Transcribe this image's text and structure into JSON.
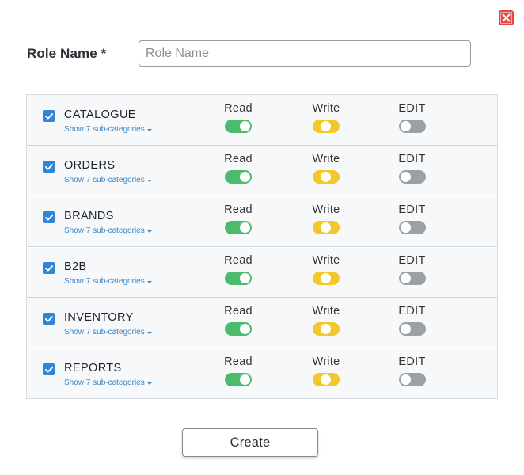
{
  "dialog": {
    "close_icon": "close-x-icon",
    "accent_color": "#e64545"
  },
  "role": {
    "label": "Role Name *",
    "placeholder": "Role Name",
    "value": ""
  },
  "permissions": {
    "columns": {
      "read": "Read",
      "write": "Write",
      "edit": "EDIT"
    },
    "sub_link": "Show 7 sub-categories",
    "colors": {
      "read": "#4cbb6c",
      "write": "#f3c82c",
      "edit": "#9aa0a6",
      "checkbox": "#2f86d8",
      "link": "#3a86c8"
    },
    "rows": [
      {
        "name": "CATALOGUE",
        "checked": true,
        "read": "on",
        "write": "partial",
        "edit": "off"
      },
      {
        "name": "ORDERS",
        "checked": true,
        "read": "on",
        "write": "partial",
        "edit": "off"
      },
      {
        "name": "BRANDS",
        "checked": true,
        "read": "on",
        "write": "partial",
        "edit": "off"
      },
      {
        "name": "B2B",
        "checked": true,
        "read": "on",
        "write": "partial",
        "edit": "off"
      },
      {
        "name": "INVENTORY",
        "checked": true,
        "read": "on",
        "write": "partial",
        "edit": "off"
      },
      {
        "name": "REPORTS",
        "checked": true,
        "read": "on",
        "write": "partial",
        "edit": "off"
      }
    ]
  },
  "actions": {
    "create_label": "Create"
  }
}
